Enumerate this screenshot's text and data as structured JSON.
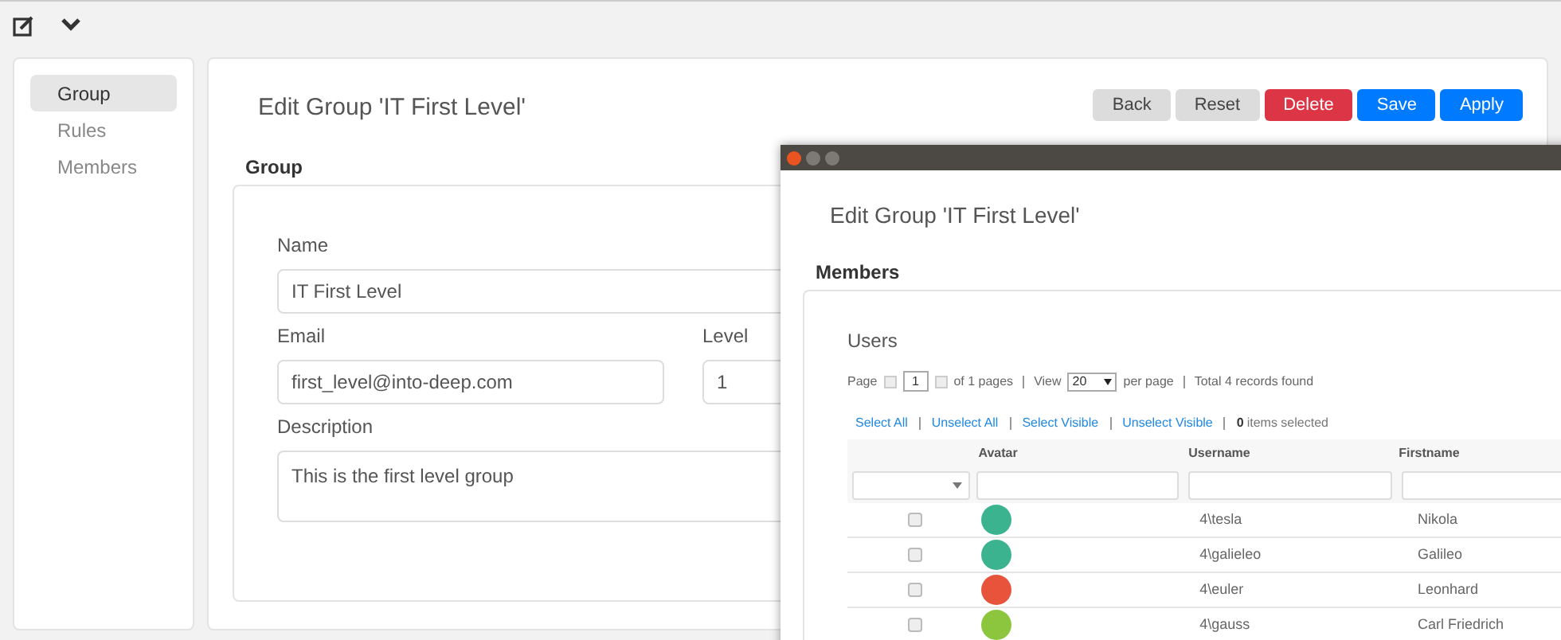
{
  "sidebar": {
    "items": [
      {
        "label": "Group",
        "selected": true
      },
      {
        "label": "Rules",
        "selected": false
      },
      {
        "label": "Members",
        "selected": false
      }
    ]
  },
  "main": {
    "title": "Edit Group 'IT First Level'",
    "buttons": [
      {
        "label": "Back",
        "kind": "default"
      },
      {
        "label": "Reset",
        "kind": "default"
      },
      {
        "label": "Delete",
        "kind": "danger"
      },
      {
        "label": "Save",
        "kind": "primary"
      },
      {
        "label": "Apply",
        "kind": "primary"
      }
    ],
    "section": "Group",
    "name_label": "Name",
    "name_value": "IT First Level",
    "email_label": "Email",
    "email_value": "first_level@into-deep.com",
    "level_label": "Level",
    "level_value": "1",
    "description_label": "Description",
    "description_value": "This is the first level group"
  },
  "window": {
    "title": "Edit Group 'IT First Level'",
    "section": "Members",
    "subtitle": "Users",
    "pager": {
      "page_label": "Page",
      "page": "1",
      "of_pages": "of 1 pages",
      "view_label": "View",
      "per_page": "20",
      "per_page_label": "per page",
      "total": "Total 4 records found"
    },
    "selection_links": [
      "Select All",
      "Unselect All",
      "Select Visible",
      "Unselect Visible"
    ],
    "selected_count": "0",
    "selected_label": "items selected",
    "columns": [
      "Avatar",
      "Username",
      "Firstname"
    ],
    "rows": [
      {
        "checked": false,
        "color": "#3cb38f",
        "username": "4\\tesla",
        "firstname": "Nikola"
      },
      {
        "checked": false,
        "color": "#3cb38f",
        "username": "4\\galieleo",
        "firstname": "Galileo"
      },
      {
        "checked": false,
        "color": "#e8533b",
        "username": "4\\euler",
        "firstname": "Leonhard"
      },
      {
        "checked": false,
        "color": "#8cc63f",
        "username": "4\\gauss",
        "firstname": "Carl Friedrich"
      }
    ]
  }
}
